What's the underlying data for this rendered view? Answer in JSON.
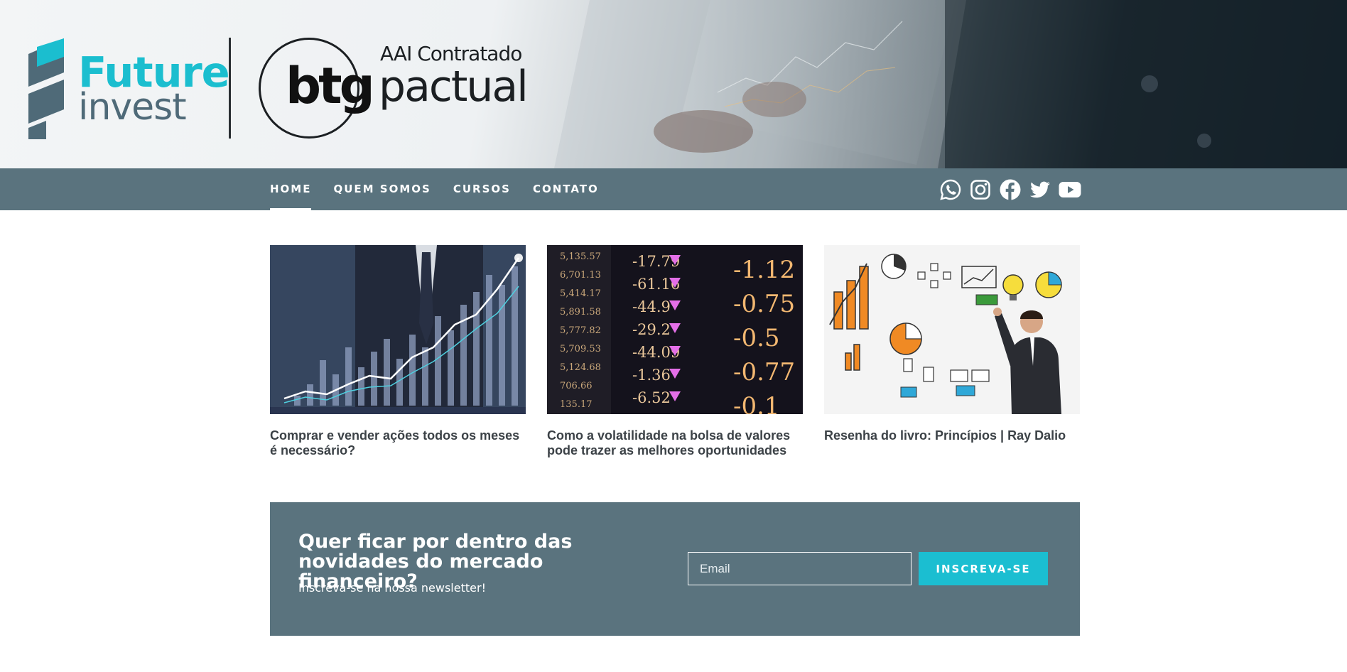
{
  "header": {
    "logo_primary": "Future",
    "logo_secondary": "invest",
    "partner_tagline": "AAI Contratado",
    "partner_brand": "btg",
    "partner_name": "pactual"
  },
  "nav": {
    "items": [
      {
        "label": "HOME",
        "active": true
      },
      {
        "label": "QUEM SOMOS",
        "active": false
      },
      {
        "label": "CURSOS",
        "active": false
      },
      {
        "label": "CONTATO",
        "active": false
      }
    ],
    "social": [
      "whatsapp-icon",
      "instagram-icon",
      "facebook-icon",
      "twitter-icon",
      "youtube-icon"
    ]
  },
  "posts": [
    {
      "title": "Comprar e vender ações todos os meses é necessário?",
      "image": "rising-chart-businessman"
    },
    {
      "title": "Como a volatilidade na bolsa de valores pode trazer as melhores oportunidades",
      "image": "stock-ticker-board"
    },
    {
      "title": "Resenha do livro: Princípios | Ray Dalio",
      "image": "business-doodles-whiteboard"
    }
  ],
  "ticker": {
    "left": [
      "5,135.57",
      "6,701.13",
      "5,414.17",
      "5,891.58",
      "5,777.82",
      "5,709.53",
      "5,124.68",
      "706.66",
      "135.17"
    ],
    "mid": [
      "-17.79",
      "-61.16",
      "-44.9",
      "-29.2",
      "-44.09",
      "-1.36",
      "-6.52"
    ],
    "right": [
      "-1.12",
      "-0.75",
      "-0.5",
      "-0.77",
      "-0.1"
    ]
  },
  "newsletter": {
    "heading": "Quer ficar por dentro das novidades do mercado financeiro?",
    "subheading": "Inscreva-se na nossa newsletter!",
    "email_placeholder": "Email",
    "button_label": "INSCREVA-SE"
  },
  "colors": {
    "brand_teal": "#1bbecf",
    "nav_slate": "#5a737e",
    "logo_slate": "#4f6a78"
  }
}
